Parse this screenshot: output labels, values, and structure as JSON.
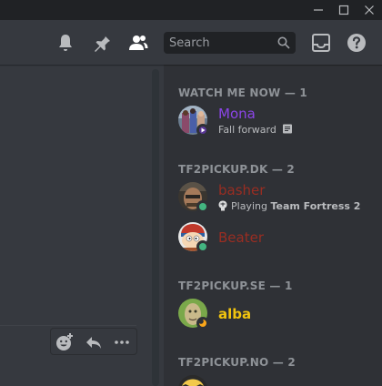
{
  "topbar": {
    "search_placeholder": "Search"
  },
  "members": {
    "sections": [
      {
        "title": "WATCH ME NOW — 1",
        "members": [
          {
            "name": "Mona",
            "activity": "Fall forward",
            "name_color": "#8b45e8",
            "status": "streaming"
          }
        ]
      },
      {
        "title": "TF2PICKUP.DK — 2",
        "members": [
          {
            "name": "basher",
            "activity_prefix": "Playing",
            "activity_game": "Team Fortress 2",
            "name_color": "#992d22",
            "status": "online"
          },
          {
            "name": "Beater",
            "name_color": "#992d22",
            "status": "online"
          }
        ]
      },
      {
        "title": "TF2PICKUP.SE — 1",
        "members": [
          {
            "name": "alba",
            "name_color": "#f1c40f",
            "status": "idle"
          }
        ]
      },
      {
        "title": "TF2PICKUP.NO — 2",
        "members": []
      }
    ]
  },
  "colors": {
    "online": "#43b581",
    "idle": "#faa61a",
    "streaming": "#593695"
  }
}
